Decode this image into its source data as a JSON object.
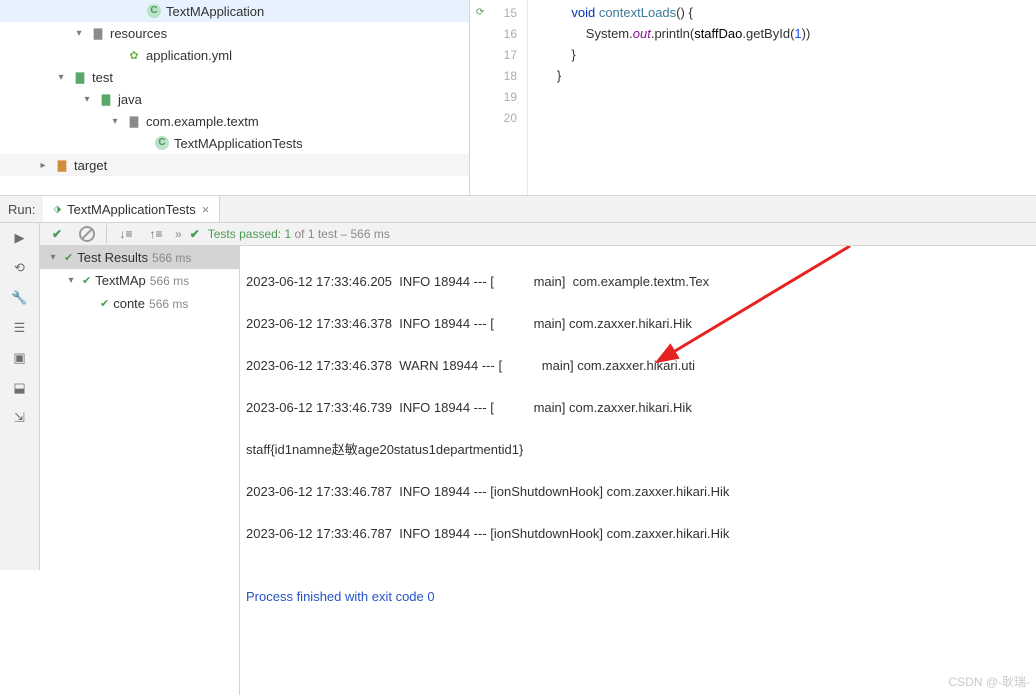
{
  "tree": {
    "n1": "TextMApplication",
    "n2": "resources",
    "n3": "application.yml",
    "n4": "test",
    "n5": "java",
    "n6": "com.example.textm",
    "n7": "TextMApplicationTests",
    "n8": "target"
  },
  "code": {
    "l15": "            void contextLoads() {",
    "l16_a": "                System.",
    "l16_b": "out",
    "l16_c": ".println(",
    "l16_d": "staffDao",
    "l16_e": ".getById(",
    "l16_f": "1",
    "l16_g": "))",
    "l17": "            }",
    "l18": "",
    "l19": "        }",
    "l20": "",
    "g15": "15",
    "g16": "16",
    "g17": "17",
    "g18": "18",
    "g19": "19",
    "g20": "20"
  },
  "run": {
    "label": "Run:",
    "tab": "TextMApplicationTests",
    "summary_a": "Tests passed: 1",
    "summary_b": " of 1 test – 566 ms",
    "tb_raquo": "»"
  },
  "testtree": {
    "r1": "Test Results",
    "r1t": "566 ms",
    "r2": "TextMAp",
    "r2t": "566 ms",
    "r3": "conte",
    "r3t": "566 ms"
  },
  "console": {
    "l1": "2023-06-12 17:33:46.205  INFO 18944 --- [           main]  com.example.textm.Tex",
    "l2": "2023-06-12 17:33:46.378  INFO 18944 --- [           main] com.zaxxer.hikari.Hik",
    "l3": "2023-06-12 17:33:46.378  WARN 18944 --- [           main] com.zaxxer.hikari.uti",
    "l4": "2023-06-12 17:33:46.739  INFO 18944 --- [           main] com.zaxxer.hikari.Hik",
    "l5": "staff{id1namne赵敏age20status1departmentid1}",
    "l6": "2023-06-12 17:33:46.787  INFO 18944 --- [ionShutdownHook] com.zaxxer.hikari.Hik",
    "l7": "2023-06-12 17:33:46.787  INFO 18944 --- [ionShutdownHook] com.zaxxer.hikari.Hik",
    "l8": "",
    "l9": "Process finished with exit code 0"
  },
  "watermark": "CSDN @-耿瑞-"
}
